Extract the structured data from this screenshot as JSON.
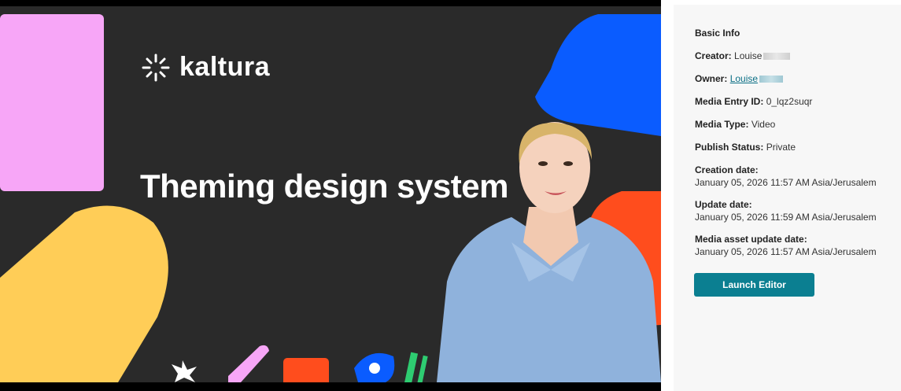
{
  "video": {
    "logo_text": "kaltura",
    "headline": "Theming design system"
  },
  "info": {
    "title": "Basic Info",
    "creator_label": "Creator:",
    "creator_value": "Louise",
    "owner_label": "Owner:",
    "owner_value": "Louise",
    "entry_id_label": "Media Entry ID:",
    "entry_id_value": "0_lqz2suqr",
    "media_type_label": "Media Type:",
    "media_type_value": "Video",
    "publish_label": "Publish Status:",
    "publish_value": "Private",
    "creation_label": "Creation date:",
    "creation_value": "January 05, 2026 11:57 AM Asia/Jerusalem",
    "update_label": "Update date:",
    "update_value": "January 05, 2026 11:59 AM Asia/Jerusalem",
    "asset_update_label": "Media asset update date:",
    "asset_update_value": "January 05, 2026 11:57 AM Asia/Jerusalem",
    "launch_label": "Launch Editor"
  }
}
